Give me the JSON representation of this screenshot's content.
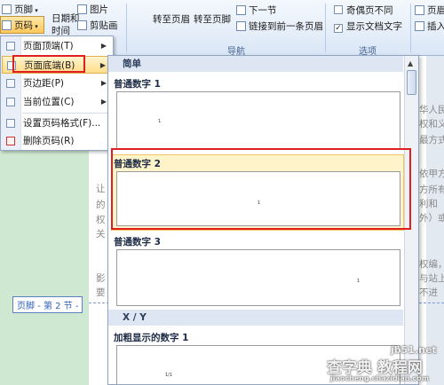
{
  "ribbon": {
    "header_footer_btn": "页脚",
    "page_number_btn": "页码",
    "datetime_btn": "日期和\n时间",
    "picture_btn": "图片",
    "clipart_btn": "剪贴画",
    "goto_header": "转至页眉",
    "goto_footer": "转至页脚",
    "next_section": "下一节",
    "link_prev": "链接到前一条页眉",
    "nav_group": "导航",
    "odd_even_diff": "奇偶页不同",
    "show_doc_text": "显示文档文字",
    "options_group": "选项",
    "header_pos": "页眉",
    "insert_align": "插入"
  },
  "menu": {
    "items": [
      {
        "label": "页面顶端(T)",
        "arrow": "▶",
        "icon": "page-top-icon"
      },
      {
        "label": "页面底端(B)",
        "arrow": "▶",
        "icon": "page-bottom-icon"
      },
      {
        "label": "页边距(P)",
        "arrow": "▶",
        "icon": "page-margin-icon"
      },
      {
        "label": "当前位置(C)",
        "arrow": "▶",
        "icon": "current-position-icon"
      },
      {
        "label": "设置页码格式(F)...",
        "arrow": "",
        "icon": "format-page-number-icon"
      },
      {
        "label": "删除页码(R)",
        "arrow": "",
        "icon": "delete-page-number-icon"
      }
    ]
  },
  "gallery": {
    "section_simple": "简单",
    "item1": "普通数字 1",
    "item2": "普通数字 2",
    "item3": "普通数字 3",
    "section_xy": "X / Y",
    "item4": "加粗显示的数字 1",
    "sample_num": "1",
    "sample_xy": "1/1"
  },
  "document": {
    "footer_label": "页脚 - 第 2 节 -",
    "text_left": [
      "让",
      "的",
      "权",
      "关",
      "影",
      "要"
    ],
    "text_right": [
      "华人民共",
      "权和义务",
      "最方式",
      "依甲方",
      "方所有",
      "利和（",
      "外）或",
      "权编，",
      "与站上",
      "不进"
    ]
  },
  "watermark": {
    "line1": "jb51.net",
    "line2": "查字典 教程网",
    "line3": "jiaocheng.chazidian.com"
  }
}
